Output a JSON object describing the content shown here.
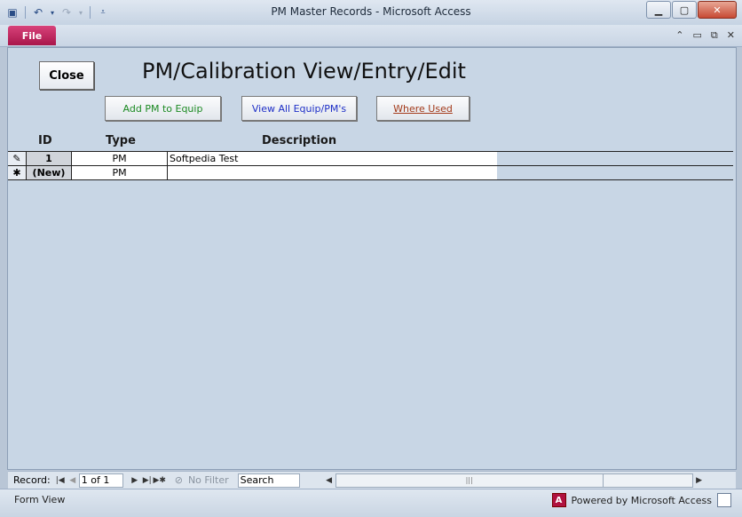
{
  "window": {
    "title": "PM Master Records  -  Microsoft Access",
    "controls": {
      "minimize": "▁",
      "maximize": "▢",
      "close": "✕"
    }
  },
  "ribbon": {
    "file_tab": "File",
    "doc_controls": {
      "expand": "⌃",
      "minimize": "▭",
      "restore": "⧉",
      "close": "✕"
    }
  },
  "form": {
    "close_button": "Close",
    "title": "PM/Calibration View/Entry/Edit",
    "buttons": {
      "add_pm": "Add PM to Equip",
      "view_all": "View All Equip/PM's",
      "where_used": "Where Used"
    },
    "columns": {
      "id": "ID",
      "type": "Type",
      "description": "Description"
    },
    "rows": [
      {
        "selector": "✎",
        "id": "1",
        "type": "PM",
        "description": "Softpedia Test"
      },
      {
        "selector": "✱",
        "id": "(New)",
        "type": "PM",
        "description": ""
      }
    ]
  },
  "navigation": {
    "record_label": "Record:",
    "record_value": "1 of 1",
    "no_filter": "No Filter",
    "search_placeholder": "Search"
  },
  "status": {
    "view": "Form View",
    "powered_by": "Powered by Microsoft Access",
    "logo_letter": "A"
  },
  "colors": {
    "file_tab": "#c2185b",
    "add_pm_text": "#1b8a22",
    "view_all_text": "#1e2fc7",
    "where_used_text": "#a33a1a"
  }
}
